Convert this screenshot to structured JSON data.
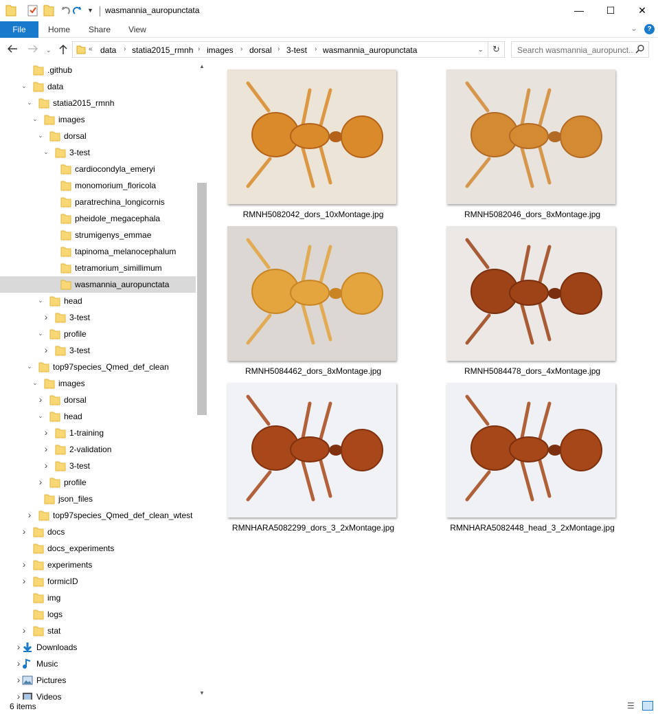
{
  "window": {
    "title": "wasmannia_auropunctata",
    "controls": {
      "minimize": "—",
      "maximize": "☐",
      "close": "✕"
    }
  },
  "ribbon": {
    "tabs": {
      "file": "File",
      "home": "Home",
      "share": "Share",
      "view": "View"
    },
    "help": "?"
  },
  "address": {
    "overflow": "«",
    "crumbs": [
      "data",
      "statia2015_rmnh",
      "images",
      "dorsal",
      "3-test",
      "wasmannia_auropunctata"
    ]
  },
  "search": {
    "placeholder": "Search wasmannia_auropunct..."
  },
  "tree": [
    {
      "label": ".github",
      "chevron": "",
      "level": 2
    },
    {
      "label": "data",
      "chevron": "open",
      "level": 2
    },
    {
      "label": "statia2015_rmnh",
      "chevron": "open",
      "level": 3
    },
    {
      "label": "images",
      "chevron": "open",
      "level": 4
    },
    {
      "label": "dorsal",
      "chevron": "open",
      "level": 5
    },
    {
      "label": "3-test",
      "chevron": "open",
      "level": 6
    },
    {
      "label": "cardiocondyla_emeryi",
      "chevron": "",
      "level": 7
    },
    {
      "label": "monomorium_floricola",
      "chevron": "",
      "level": 7
    },
    {
      "label": "paratrechina_longicornis",
      "chevron": "",
      "level": 7
    },
    {
      "label": "pheidole_megacephala",
      "chevron": "",
      "level": 7
    },
    {
      "label": "strumigenys_emmae",
      "chevron": "",
      "level": 7
    },
    {
      "label": "tapinoma_melanocephalum",
      "chevron": "",
      "level": 7
    },
    {
      "label": "tetramorium_simillimum",
      "chevron": "",
      "level": 7
    },
    {
      "label": "wasmannia_auropunctata",
      "chevron": "",
      "level": 7,
      "selected": true
    },
    {
      "label": "head",
      "chevron": "open",
      "level": 5
    },
    {
      "label": "3-test",
      "chevron": "closed",
      "level": 6
    },
    {
      "label": "profile",
      "chevron": "open",
      "level": 5
    },
    {
      "label": "3-test",
      "chevron": "closed",
      "level": 6
    },
    {
      "label": "top97species_Qmed_def_clean",
      "chevron": "open",
      "level": 3
    },
    {
      "label": "images",
      "chevron": "open",
      "level": 4
    },
    {
      "label": "dorsal",
      "chevron": "closed",
      "level": 5
    },
    {
      "label": "head",
      "chevron": "open",
      "level": 5
    },
    {
      "label": "1-training",
      "chevron": "closed",
      "level": 6
    },
    {
      "label": "2-validation",
      "chevron": "closed",
      "level": 6
    },
    {
      "label": "3-test",
      "chevron": "closed",
      "level": 6
    },
    {
      "label": "profile",
      "chevron": "closed",
      "level": 5
    },
    {
      "label": "json_files",
      "chevron": "",
      "level": 4
    },
    {
      "label": "top97species_Qmed_def_clean_wtest",
      "chevron": "closed",
      "level": 3
    },
    {
      "label": "docs",
      "chevron": "closed",
      "level": 2
    },
    {
      "label": "docs_experiments",
      "chevron": "",
      "level": 2
    },
    {
      "label": "experiments",
      "chevron": "closed",
      "level": 2
    },
    {
      "label": "formicID",
      "chevron": "closed",
      "level": 2
    },
    {
      "label": "img",
      "chevron": "",
      "level": 2
    },
    {
      "label": "logs",
      "chevron": "",
      "level": 2
    },
    {
      "label": "stat",
      "chevron": "closed",
      "level": 2
    },
    {
      "label": "Downloads",
      "chevron": "closed",
      "level": 1,
      "icon": "download"
    },
    {
      "label": "Music",
      "chevron": "closed",
      "level": 1,
      "icon": "music"
    },
    {
      "label": "Pictures",
      "chevron": "closed",
      "level": 1,
      "icon": "pictures"
    },
    {
      "label": "Videos",
      "chevron": "closed",
      "level": 1,
      "icon": "videos"
    }
  ],
  "files": [
    {
      "name": "RMNH5082042_dors_10xMontage.jpg",
      "bg": "#ece4d6",
      "body": "#d98a2a",
      "dark": "#b4621a"
    },
    {
      "name": "RMNH5082046_dors_8xMontage.jpg",
      "bg": "#e8e3dc",
      "body": "#d48a33",
      "dark": "#b26a24"
    },
    {
      "name": "RMNH5084462_dors_8xMontage.jpg",
      "bg": "#dcd7d2",
      "body": "#e4a43e",
      "dark": "#c98424"
    },
    {
      "name": "RMNH5084478_dors_4xMontage.jpg",
      "bg": "#ebe8e6",
      "body": "#9e4318",
      "dark": "#7a2f0e"
    },
    {
      "name": "RMNHARA5082299_dors_3_2xMontage.jpg",
      "bg": "#f0f2f5",
      "body": "#a8481a",
      "dark": "#7f3110"
    },
    {
      "name": "RMNHARA5082448_head_3_2xMontage.jpg",
      "bg": "#eff1f4",
      "body": "#a54718",
      "dark": "#7c300f"
    }
  ],
  "status": {
    "count": "6 items"
  }
}
